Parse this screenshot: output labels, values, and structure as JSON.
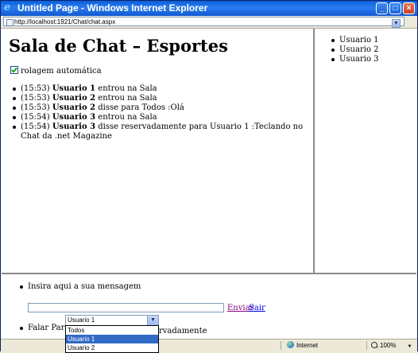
{
  "window": {
    "title": "Untitled Page - Windows Internet Explorer",
    "address": "http://localhost:1921/Chat/chat.aspx"
  },
  "chat": {
    "heading": "Sala de Chat – Esportes",
    "autoscroll_label": "rolagem automática",
    "autoscroll_checked": true,
    "messages": [
      {
        "time": "(15:53)",
        "user": "Usuario 1",
        "text": " entrou na Sala"
      },
      {
        "time": "(15:53)",
        "user": "Usuario 2",
        "text": " entrou na Sala"
      },
      {
        "time": "(15:53)",
        "user": "Usuario 2",
        "text": " disse para Todos :Olá"
      },
      {
        "time": "(15:54)",
        "user": "Usuario 3",
        "text": " entrou na Sala"
      },
      {
        "time": "(15:54)",
        "user": "Usuario 3",
        "text": " disse reservadamente para Usuario 1 :Teclando no Chat da .net Magazine"
      }
    ]
  },
  "users": [
    "Usuario 1",
    "Usuario 2",
    "Usuario 3"
  ],
  "compose": {
    "prompt": "Insira aqui a sua mensagem",
    "message_value": "",
    "send_label": "Enviar",
    "exit_label": "Sair",
    "to_label": "Falar Para",
    "to_selected": "Usuario 1",
    "to_options": [
      "Todos",
      "Usuario 1",
      "Usuario 2"
    ],
    "private_partial": "rvadamente"
  },
  "status": {
    "zone": "Internet",
    "zoom": "100%"
  }
}
